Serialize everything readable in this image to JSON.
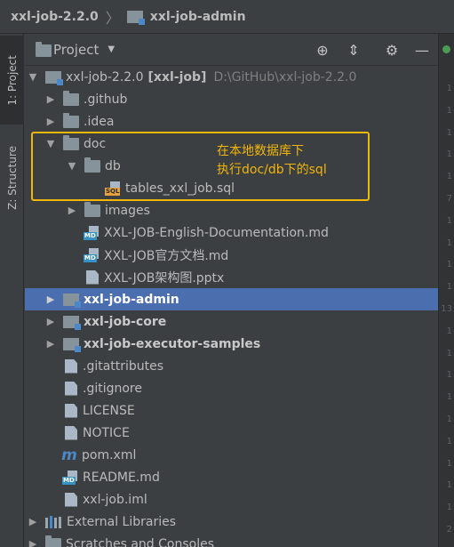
{
  "breadcrumb": {
    "root": "xxl-job-2.2.0",
    "child": "xxl-job-admin"
  },
  "side_strip": {
    "project_tab": "1: Project",
    "structure_tab": "Z: Structure"
  },
  "panel": {
    "title": "Project"
  },
  "tree": {
    "root": {
      "name": "xxl-job-2.2.0",
      "bracket": "[xxl-job]",
      "path": "D:\\GitHub\\xxl-job-2.2.0"
    },
    "items": [
      ".github",
      ".idea",
      "doc",
      "db",
      "tables_xxl_job.sql",
      "images",
      "XXL-JOB-English-Documentation.md",
      "XXL-JOB官方文档.md",
      "XXL-JOB架构图.pptx",
      "xxl-job-admin",
      "xxl-job-core",
      "xxl-job-executor-samples",
      ".gitattributes",
      ".gitignore",
      "LICENSE",
      "NOTICE",
      "pom.xml",
      "README.md",
      "xxl-job.iml",
      "External Libraries",
      "Scratches and Consoles"
    ],
    "badges": {
      "md": "MD",
      "sql": "SQL"
    }
  },
  "annotation": {
    "line1": "在本地数据库下",
    "line2": "执行doc/db下的sql"
  },
  "gutter": {
    "lines": [
      "1",
      "1",
      "1",
      "1",
      "1",
      "7",
      "1",
      "1",
      "1",
      "1",
      "13",
      "1",
      "1",
      "1",
      "1",
      "1",
      "1",
      "1",
      "1",
      "1",
      "2",
      "2"
    ]
  },
  "colors": {
    "selection": "#4b6eaf",
    "annotation": "#f0b60a",
    "module_badge": "#4a88c7"
  }
}
